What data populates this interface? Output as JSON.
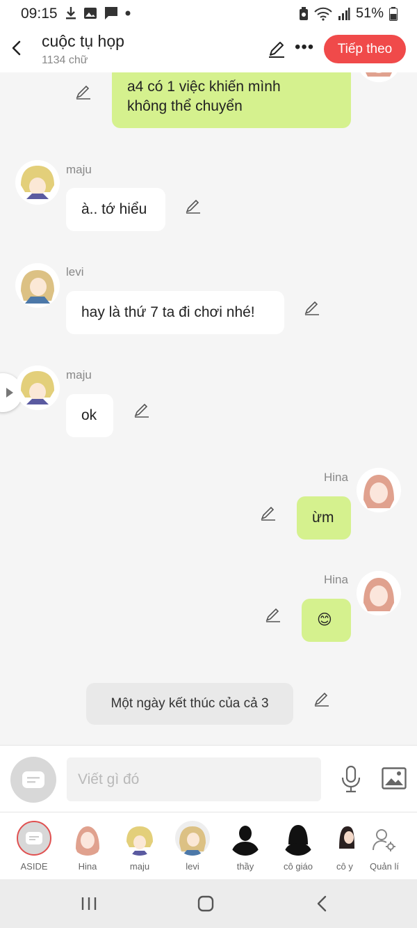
{
  "status_bar": {
    "time": "09:15",
    "battery": "51%"
  },
  "header": {
    "title": "cuộc tụ họp",
    "subtitle": "1134 chữ",
    "next_label": "Tiếp theo"
  },
  "messages": [
    {
      "text_line1": "a4 có 1 việc khiến mình",
      "text_line2": "không thể chuyển"
    },
    {
      "name": "maju",
      "text": "à.. tớ hiểu"
    },
    {
      "name": "levi",
      "text": "hay là thứ 7 ta đi chơi nhé!"
    },
    {
      "name": "maju",
      "text": "ok"
    },
    {
      "name": "Hina",
      "text": "ừm"
    },
    {
      "name": "Hina",
      "text": "😊"
    },
    {
      "text": "Một ngày kết thúc của cả 3"
    }
  ],
  "input": {
    "placeholder": "Viết gì đó"
  },
  "characters": [
    {
      "label": "ASIDE"
    },
    {
      "label": "Hina"
    },
    {
      "label": "maju"
    },
    {
      "label": "levi"
    },
    {
      "label": "thầy"
    },
    {
      "label": "cô giáo"
    },
    {
      "label": "cô y"
    },
    {
      "label": "Quản lí"
    }
  ],
  "colors": {
    "accent": "#f04a4a",
    "bubble_green": "#d5f18e",
    "bubble_white": "#ffffff",
    "narration_gray": "#e9e9e9",
    "background": "#f5f5f5"
  },
  "icons": [
    "back-arrow-icon",
    "pencil-icon",
    "more-icon",
    "microphone-icon",
    "image-icon",
    "aside-icon",
    "manage-user-icon",
    "recent-apps-icon",
    "home-icon",
    "nav-back-icon"
  ]
}
